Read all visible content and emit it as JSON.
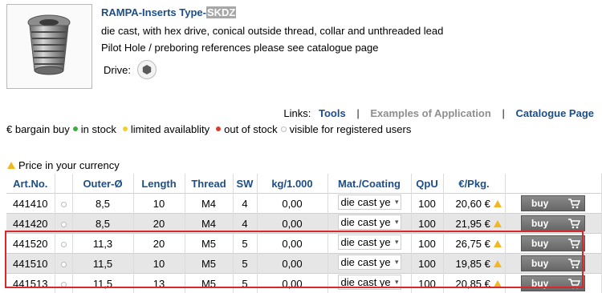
{
  "product": {
    "title_main": "RAMPA-Inserts Type-",
    "title_highlight": "SKDZ",
    "description": "die cast, with hex drive, conical outside thread, collar and unthreaded lead",
    "pilot_hole": "Pilot Hole / preboring references please see catalogue page",
    "drive_label": "Drive:"
  },
  "links": {
    "label": "Links:",
    "items": [
      "Tools",
      "Examples of Application",
      "Catalogue Page"
    ],
    "separator": "|"
  },
  "legend": {
    "bargain": "€ bargain buy",
    "in_stock": "in stock",
    "limited": "limited availablity",
    "out_of_stock": "out of stock",
    "registered": "visible for registered users"
  },
  "price_currency": "Price in your currency",
  "table": {
    "headers": [
      "Art.No.",
      "",
      "Outer-Ø",
      "Length",
      "Thread",
      "SW",
      "kg/1.000",
      "Mat./Coating",
      "QpU",
      "€/Pkg.",
      ""
    ],
    "rows": [
      {
        "art": "441410",
        "outer": "8,5",
        "length": "10",
        "thread": "M4",
        "sw": "4",
        "kg": "0,00",
        "mat": "die cast ye",
        "qpu": "100",
        "price": "20,60 €",
        "buy": "buy"
      },
      {
        "art": "441420",
        "outer": "8,5",
        "length": "20",
        "thread": "M4",
        "sw": "4",
        "kg": "0,00",
        "mat": "die cast ye",
        "qpu": "100",
        "price": "21,95 €",
        "buy": "buy"
      },
      {
        "art": "441520",
        "outer": "11,3",
        "length": "20",
        "thread": "M5",
        "sw": "5",
        "kg": "0,00",
        "mat": "die cast ye",
        "qpu": "100",
        "price": "26,75 €",
        "buy": "buy"
      },
      {
        "art": "441510",
        "outer": "11,5",
        "length": "10",
        "thread": "M5",
        "sw": "5",
        "kg": "0,00",
        "mat": "die cast ye",
        "qpu": "100",
        "price": "19,85 €",
        "buy": "buy"
      },
      {
        "art": "441513",
        "outer": "11,5",
        "length": "13",
        "thread": "M5",
        "sw": "5",
        "kg": "0,00",
        "mat": "die cast ye",
        "qpu": "100",
        "price": "20,85 €",
        "buy": "buy"
      }
    ]
  },
  "icons": {
    "product_image": "threaded-insert-image",
    "drive": "hex-drive-icon",
    "warning": "warning-triangle-icon",
    "cart": "cart-icon"
  },
  "colors": {
    "link_blue": "#1d4e89",
    "highlight_border": "#d9272e",
    "row_alt": "#e6e6e6",
    "in_stock": "#3cae3c",
    "limited": "#f2cf2c",
    "out_of_stock": "#e23a26"
  }
}
